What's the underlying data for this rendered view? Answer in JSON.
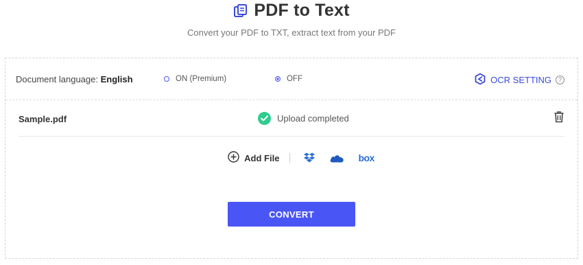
{
  "header": {
    "title": "PDF to Text",
    "subtitle": "Convert your PDF to TXT, extract text from your PDF",
    "title_icon": "copy-documents-icon"
  },
  "options": {
    "language_label": "Document language:",
    "language_value": "English",
    "ocr_on_label": "ON (Premium)",
    "ocr_off_label": "OFF",
    "ocr_selected": "OFF",
    "ocr_setting_label": "OCR SETTING",
    "help_glyph": "?"
  },
  "file": {
    "name": "Sample.pdf",
    "status": "Upload completed"
  },
  "sources": {
    "add_file_label": "Add File",
    "dropbox_icon": "dropbox-icon",
    "onedrive_icon": "onedrive-icon",
    "box_label": "box"
  },
  "actions": {
    "convert_label": "CONVERT"
  },
  "colors": {
    "accent": "#4a55f5",
    "success": "#2ecc8f",
    "link": "#3a4ad9"
  }
}
